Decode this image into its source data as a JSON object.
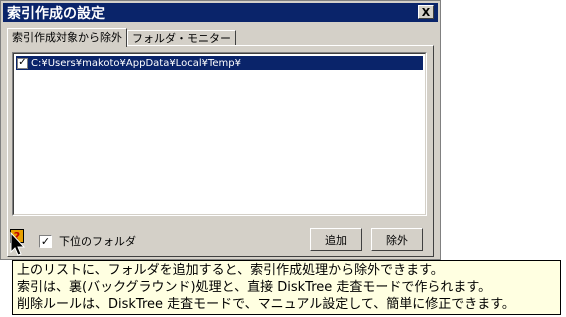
{
  "window": {
    "title": "索引作成の設定",
    "close_label": "X"
  },
  "tabs": [
    {
      "label": "索引作成対象から除外"
    },
    {
      "label": "フォルダ・モニター"
    }
  ],
  "exclude_list": {
    "items": [
      {
        "checked": true,
        "check_mark": "✓",
        "path": "C:¥Users¥makoto¥AppData¥Local¥Temp¥"
      }
    ]
  },
  "subfolder_checkbox": {
    "checked": true,
    "check_mark": "✓",
    "label": "下位のフォルダ"
  },
  "buttons": {
    "add_label": "追加",
    "remove_label": "除外"
  },
  "help_icon": {
    "name": "help-icon",
    "glyph": "?"
  },
  "tooltip": {
    "lines": [
      "上のリストに、フォルダを追加すると、索引作成処理から除外できます。",
      "索引は、裏(バックグラウンド)処理と、直接 DiskTree 走査モードで作られます。",
      "削除ルールは、DiskTree 走査モードで、マニュアル設定して、簡単に修正できます。"
    ]
  },
  "colors": {
    "title_bar": "#0a246a",
    "dialog_face": "#d4d0c8",
    "selection": "#0a246a",
    "tooltip_bg": "#ffffe1"
  }
}
